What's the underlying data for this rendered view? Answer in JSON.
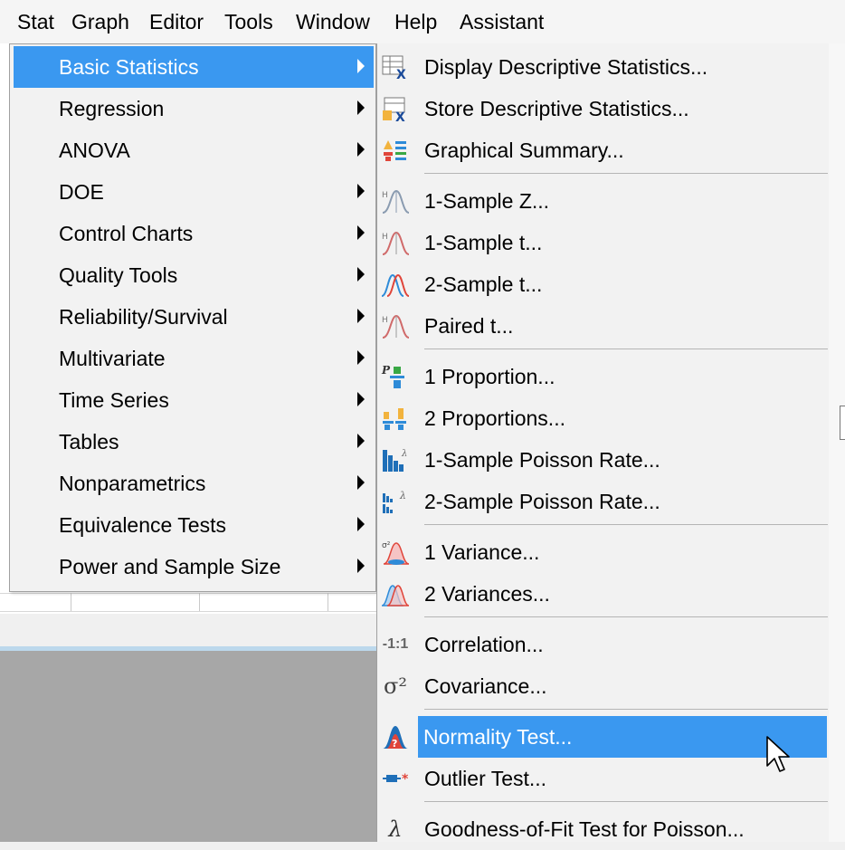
{
  "menubar": [
    "Stat",
    "Graph",
    "Editor",
    "Tools",
    "Window",
    "Help",
    "Assistant"
  ],
  "stat_menu": {
    "items": [
      {
        "label": "Basic Statistics",
        "active": true
      },
      {
        "label": "Regression"
      },
      {
        "label": "ANOVA"
      },
      {
        "label": "DOE"
      },
      {
        "label": "Control Charts"
      },
      {
        "label": "Quality Tools"
      },
      {
        "label": "Reliability/Survival"
      },
      {
        "label": "Multivariate"
      },
      {
        "label": "Time Series"
      },
      {
        "label": "Tables"
      },
      {
        "label": "Nonparametrics"
      },
      {
        "label": "Equivalence Tests"
      },
      {
        "label": "Power and Sample Size"
      }
    ]
  },
  "basic_statistics_menu": {
    "items": [
      {
        "label": "Display Descriptive Statistics...",
        "icon": "descriptive-stats-table-icon"
      },
      {
        "label": "Store Descriptive Statistics...",
        "icon": "store-descriptive-stats-icon"
      },
      {
        "label": "Graphical Summary...",
        "icon": "graphical-summary-icon"
      },
      {
        "label": "1-Sample Z...",
        "icon": "one-sample-z-icon"
      },
      {
        "label": "1-Sample t...",
        "icon": "one-sample-t-icon"
      },
      {
        "label": "2-Sample t...",
        "icon": "two-sample-t-icon"
      },
      {
        "label": "Paired t...",
        "icon": "paired-t-icon"
      },
      {
        "label": "1 Proportion...",
        "icon": "one-proportion-icon"
      },
      {
        "label": "2 Proportions...",
        "icon": "two-proportions-icon"
      },
      {
        "label": "1-Sample Poisson Rate...",
        "icon": "one-sample-poisson-icon"
      },
      {
        "label": "2-Sample Poisson Rate...",
        "icon": "two-sample-poisson-icon"
      },
      {
        "label": "1 Variance...",
        "icon": "one-variance-icon"
      },
      {
        "label": "2 Variances...",
        "icon": "two-variances-icon"
      },
      {
        "label": "Correlation...",
        "icon": "correlation-icon",
        "glyph": "-1:1"
      },
      {
        "label": "Covariance...",
        "icon": "covariance-icon",
        "glyph": "σ²"
      },
      {
        "label": "Normality Test...",
        "icon": "normality-test-icon",
        "active": true
      },
      {
        "label": "Outlier Test...",
        "icon": "outlier-test-icon"
      },
      {
        "label": "Goodness-of-Fit Test for Poisson...",
        "icon": "lambda-icon",
        "glyph": "λ"
      }
    ]
  },
  "colors": {
    "highlight": "#3a98f0",
    "menu_bg": "#f2f2f2",
    "separator": "#b5b5b5"
  }
}
